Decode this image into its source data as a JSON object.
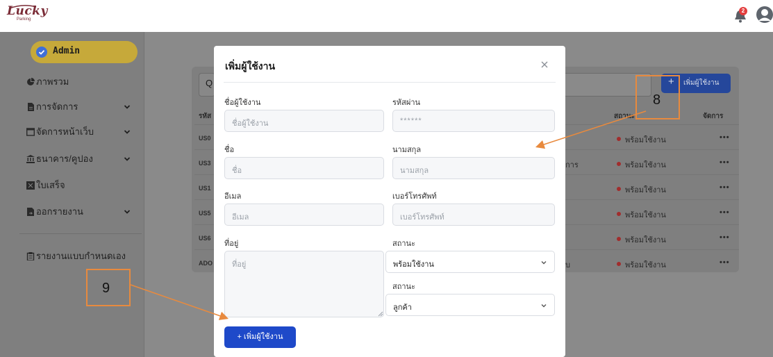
{
  "app": {
    "logo_text": "Lucky",
    "logo_sub": "Parking",
    "notification_count": "2"
  },
  "sidebar": {
    "items": [
      {
        "label": "Admin",
        "icon": "check-circle-icon"
      },
      {
        "label": "ภาพรวม",
        "icon": "pie-chart-icon"
      },
      {
        "label": "การจัดการ",
        "icon": "document-icon"
      },
      {
        "label": "จัดการหน้าเว็บ",
        "icon": "browser-window-icon"
      },
      {
        "label": "ธนาคาร/คูปอง",
        "icon": "bank-icon"
      },
      {
        "label": "ใบเสร็จ",
        "icon": "receipt-icon"
      },
      {
        "label": "ออกรายงาน",
        "icon": "file-export-icon"
      },
      {
        "label": "รายงานแบบกำหนดเอง",
        "icon": "clipboard-icon"
      }
    ]
  },
  "background": {
    "search_partial": "Q",
    "add_button": "เพิ่มผู้ใช้งาน",
    "columns": {
      "code": "รหัส",
      "status": "สถานะ",
      "actions": "จัดการ"
    },
    "rows": [
      {
        "code": "US0",
        "status": "พร้อมใช้งาน",
        "extra": ""
      },
      {
        "code": "US3",
        "status": "พร้อมใช้งาน",
        "extra": "การ"
      },
      {
        "code": "US1",
        "status": "พร้อมใช้งาน",
        "extra": ""
      },
      {
        "code": "US5",
        "status": "พร้อมใช้งาน",
        "extra": ""
      },
      {
        "code": "US6",
        "status": "พร้อมใช้งาน",
        "extra": ""
      },
      {
        "code": "ADO",
        "status": "พร้อมใช้งาน",
        "extra": "บ"
      }
    ],
    "more": "•••"
  },
  "modal": {
    "title": "เพิ่มผู้ใช้งาน",
    "fields": {
      "username": {
        "label": "ชื่อผู้ใช้งาน",
        "placeholder": "ชื่อผู้ใช้งาน"
      },
      "password": {
        "label": "รหัสผ่าน",
        "placeholder": "******"
      },
      "first_name": {
        "label": "ชื่อ",
        "placeholder": "ชื่อ"
      },
      "last_name": {
        "label": "นามสกุล",
        "placeholder": "นามสกุล"
      },
      "email": {
        "label": "อีเมล",
        "placeholder": "อีเมล"
      },
      "phone": {
        "label": "เบอร์โทรศัพท์",
        "placeholder": "เบอร์โทรศัพท์"
      },
      "address": {
        "label": "ที่อยู่",
        "placeholder": "ที่อยู่"
      },
      "status": {
        "label": "สถานะ",
        "value": "พร้อมใช้งาน"
      },
      "type": {
        "label": "สถานะ",
        "value": "ลูกค้า"
      }
    },
    "submit_label": "+ เพิ่มผู้ใช้งาน"
  },
  "annotations": {
    "box_8": "8",
    "box_9": "9"
  },
  "colors": {
    "accent": "#1e49c9",
    "annotation": "#e88a3e",
    "admin_pill": "#c6a93a",
    "status_dot": "#a12d2d"
  }
}
